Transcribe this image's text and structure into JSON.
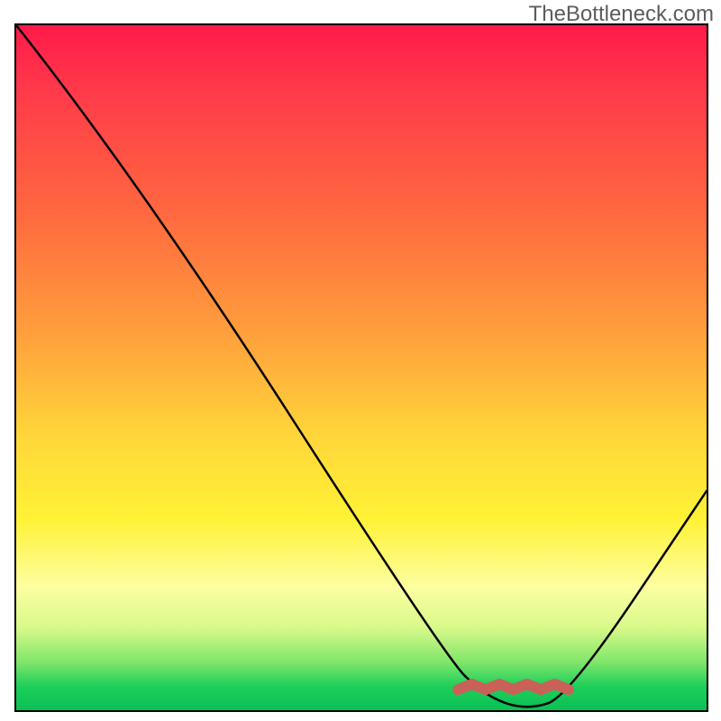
{
  "watermark": "TheBottleneck.com",
  "chart_data": {
    "type": "line",
    "title": "",
    "xlabel": "",
    "ylabel": "",
    "xlim": [
      0,
      100
    ],
    "ylim": [
      0,
      100
    ],
    "series": [
      {
        "name": "bottleneck-curve",
        "color": "#000000",
        "x": [
          0,
          18,
          62,
          68,
          74,
          80,
          100
        ],
        "y": [
          100,
          77,
          8,
          2,
          0,
          2,
          32
        ]
      }
    ],
    "markers": [
      {
        "name": "highlight-range",
        "color": "#c96158",
        "x": [
          64,
          80
        ],
        "y": [
          3,
          3
        ]
      }
    ],
    "background": "vertical-rainbow-gradient"
  }
}
